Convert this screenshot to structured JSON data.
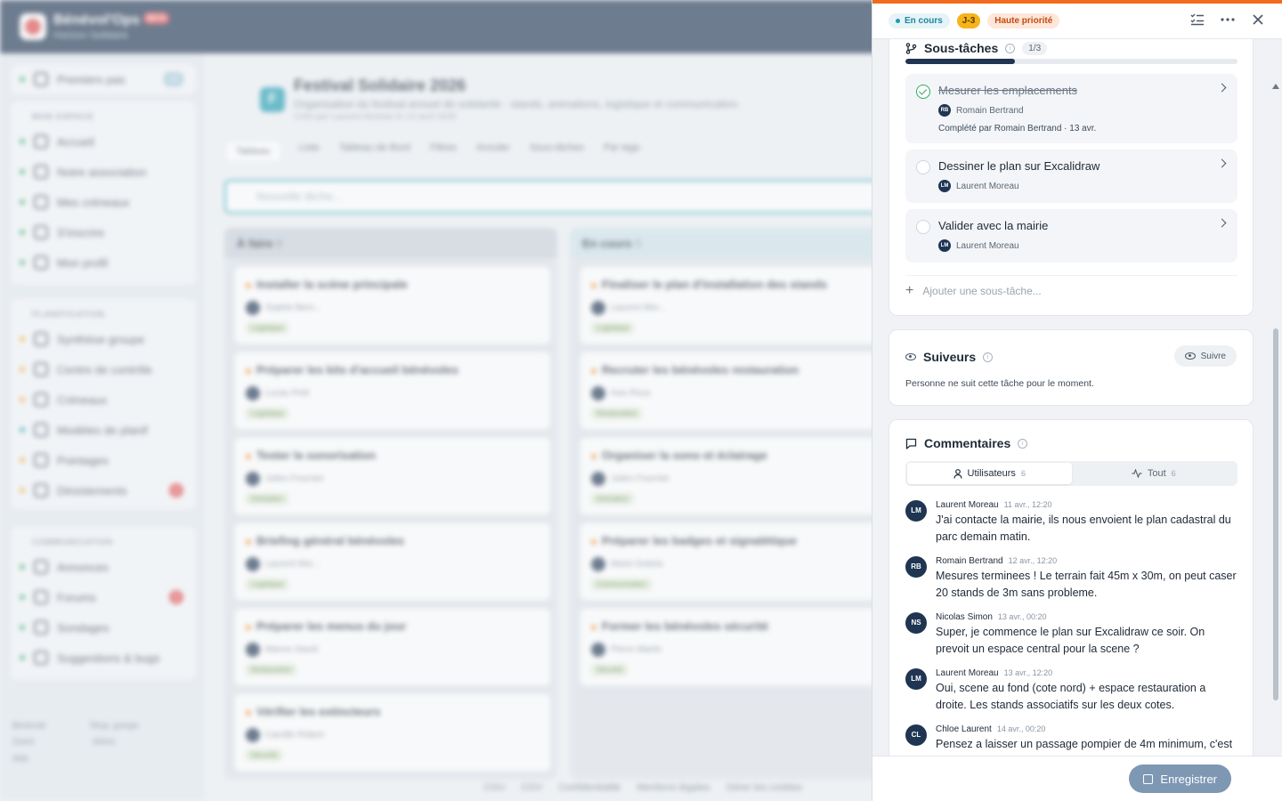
{
  "app": {
    "name": "Bénévol'Ops",
    "badge": "BETA",
    "org": "Horizon Solidaire"
  },
  "sidebar": {
    "first_step": {
      "label": "Premiers pas",
      "count": "4/8"
    },
    "groups": [
      {
        "title": "MON ESPACE",
        "items": [
          "Accueil",
          "Notre association",
          "Mes créneaux",
          "S'inscrire",
          "Mon profil"
        ]
      },
      {
        "title": "PLANIFICATION",
        "items": [
          "Synthèse groupe",
          "Centre de contrôle",
          "Créneaux",
          "Modèles de planif",
          "Pointages",
          "Désistements"
        ],
        "badge": "2"
      },
      {
        "title": "COMMUNICATION",
        "items": [
          "Annonces",
          "Forums",
          "Sondages",
          "Suggestions & bugs"
        ],
        "badge": "2"
      }
    ],
    "legend": [
      "Bénévole",
      "Resp. groupe",
      "Guest",
      "Admin",
      "Aide"
    ]
  },
  "board": {
    "icon_letter": "F",
    "title": "Festival Solidaire 2026",
    "subtitle": "Organisation du festival annuel de solidarité - stands, animations, logistique et communication.",
    "meta": "Créé par Laurent Moreau le 14 avril 2026",
    "toolbar": [
      "Tableau",
      "Liste",
      "Tableau de Bord",
      "Filtres",
      "Annuler",
      "Sous-tâches",
      "Par tags"
    ],
    "new_task_placeholder": "Nouvelle tâche...",
    "columns": [
      {
        "title": "À faire",
        "count": "8",
        "cards": [
          {
            "title": "Installer la scène principale",
            "who": "Sophie Bern...",
            "tag": "Logistique"
          },
          {
            "title": "Préparer les kits d'accueil bénévoles",
            "who": "Lucas Petit",
            "tag": "Logistique"
          },
          {
            "title": "Tester la sonorisation",
            "who": "Julien Fournier",
            "tag": "Animation"
          },
          {
            "title": "Briefing général bénévoles",
            "who": "Laurent Mor...",
            "tag": "Logistique"
          },
          {
            "title": "Préparer les menus du jour",
            "who": "Manon David",
            "tag": "Restauration"
          },
          {
            "title": "Vérifier les extincteurs",
            "who": "Camille Robert",
            "tag": "Sécurité"
          }
        ]
      },
      {
        "title": "En cours",
        "count": "5",
        "cards": [
          {
            "title": "Finaliser le plan d'installation des stands",
            "who": "Laurent Mor...",
            "tag": "Logistique"
          },
          {
            "title": "Recruter les bénévoles restauration",
            "who": "Ines Roux",
            "tag": "Restauration"
          },
          {
            "title": "Organiser la sono et éclairage",
            "who": "Julien Fournier",
            "tag": "Animation"
          },
          {
            "title": "Préparer les badges et signalétique",
            "who": "Marie Dubois",
            "tag": "Communication"
          },
          {
            "title": "Former les bénévoles sécurité",
            "who": "Pierre Martin",
            "tag": "Sécurité"
          }
        ]
      }
    ]
  },
  "footer_links": [
    "CGU",
    "CGV",
    "Confidentialité",
    "Mentions légales",
    "Gérer les cookies"
  ],
  "drawer": {
    "status": "En cours",
    "due": "J-3",
    "priority": "Haute priorité",
    "subtasks": {
      "title": "Sous-tâches",
      "count": "1/3",
      "progress": 0.33,
      "items": [
        {
          "title": "Mesurer les emplacements",
          "initials": "RB",
          "user": "Romain Bertrand",
          "done": true,
          "done_note": "Complété par Romain Bertrand · 13 avr."
        },
        {
          "title": "Dessiner le plan sur Excalidraw",
          "initials": "LM",
          "user": "Laurent Moreau",
          "done": false
        },
        {
          "title": "Valider avec la mairie",
          "initials": "LM",
          "user": "Laurent Moreau",
          "done": false
        }
      ],
      "add_placeholder": "Ajouter une sous-tâche..."
    },
    "followers": {
      "title": "Suiveurs",
      "follow_label": "Suivre",
      "empty_text": "Personne ne suit cette tâche pour le moment."
    },
    "comments": {
      "title": "Commentaires",
      "tabs": [
        {
          "label": "Utilisateurs",
          "count": "6"
        },
        {
          "label": "Tout",
          "count": "6"
        }
      ],
      "items": [
        {
          "initials": "LM",
          "author": "Laurent Moreau",
          "date": "11 avr., 12:20",
          "text": "J'ai contacte la mairie, ils nous envoient le plan cadastral du parc demain matin."
        },
        {
          "initials": "RB",
          "author": "Romain Bertrand",
          "date": "12 avr., 12:20",
          "text": "Mesures terminees ! Le terrain fait 45m x 30m, on peut caser 20 stands de 3m sans probleme."
        },
        {
          "initials": "NS",
          "author": "Nicolas Simon",
          "date": "13 avr., 00:20",
          "text": "Super, je commence le plan sur Excalidraw ce soir. On prevoit un espace central pour la scene ?"
        },
        {
          "initials": "LM",
          "author": "Laurent Moreau",
          "date": "13 avr., 12:20",
          "text": "Oui, scene au fond (cote nord) + espace restauration a droite. Les stands associatifs sur les deux cotes."
        },
        {
          "initials": "CL",
          "author": "Chloe Laurent",
          "date": "14 avr., 00:20",
          "text": "Pensez a laisser un passage pompier de 4m minimum, c'est"
        }
      ]
    },
    "save_label": "Enregistrer"
  }
}
